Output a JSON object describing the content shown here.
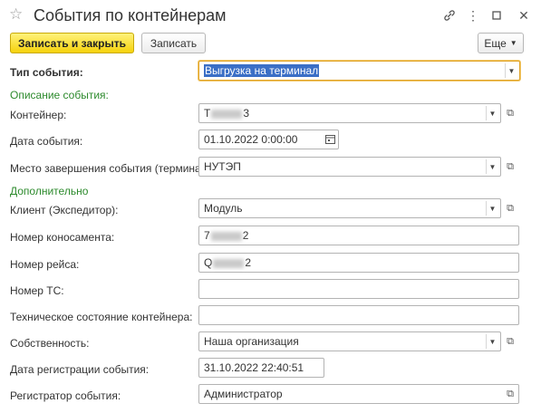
{
  "window": {
    "title": "События по контейнерам",
    "star_icon": "star-icon",
    "link_icon": "link-icon",
    "more_icon": "more-icon",
    "maximize_icon": "maximize-icon",
    "close_icon": "close-icon"
  },
  "toolbar": {
    "save_close_label": "Записать и закрыть",
    "save_label": "Записать",
    "more_label": "Еще"
  },
  "form": {
    "event_type": {
      "label": "Тип события:",
      "value": "Выгрузка на терминал"
    },
    "section_description": "Описание события:",
    "container": {
      "label": "Контейнер:",
      "value_start": "T",
      "value_end": "3"
    },
    "event_date": {
      "label": "Дата события:",
      "value": "01.10.2022  0:00:00"
    },
    "end_place": {
      "label": "Место завершения события (терминал):",
      "value": "НУТЭП"
    },
    "section_additional": "Дополнительно",
    "client": {
      "label": "Клиент (Экспедитор):",
      "value": "Модуль"
    },
    "bill_of_lading": {
      "label": "Номер коносамента:",
      "value_start": "7",
      "value_end": "2"
    },
    "voyage_number": {
      "label": "Номер рейса:",
      "value_start": "Q",
      "value_end": "2"
    },
    "vehicle_number": {
      "label": "Номер ТС:",
      "value": ""
    },
    "tech_state": {
      "label": "Техническое состояние контейнера:",
      "value": ""
    },
    "ownership": {
      "label": "Собственность:",
      "value": "Наша организация"
    },
    "registration_date": {
      "label": "Дата регистрации события:",
      "value": "31.10.2022 22:40:51"
    },
    "registrar": {
      "label": "Регистратор события:",
      "value": "Администратор"
    }
  }
}
